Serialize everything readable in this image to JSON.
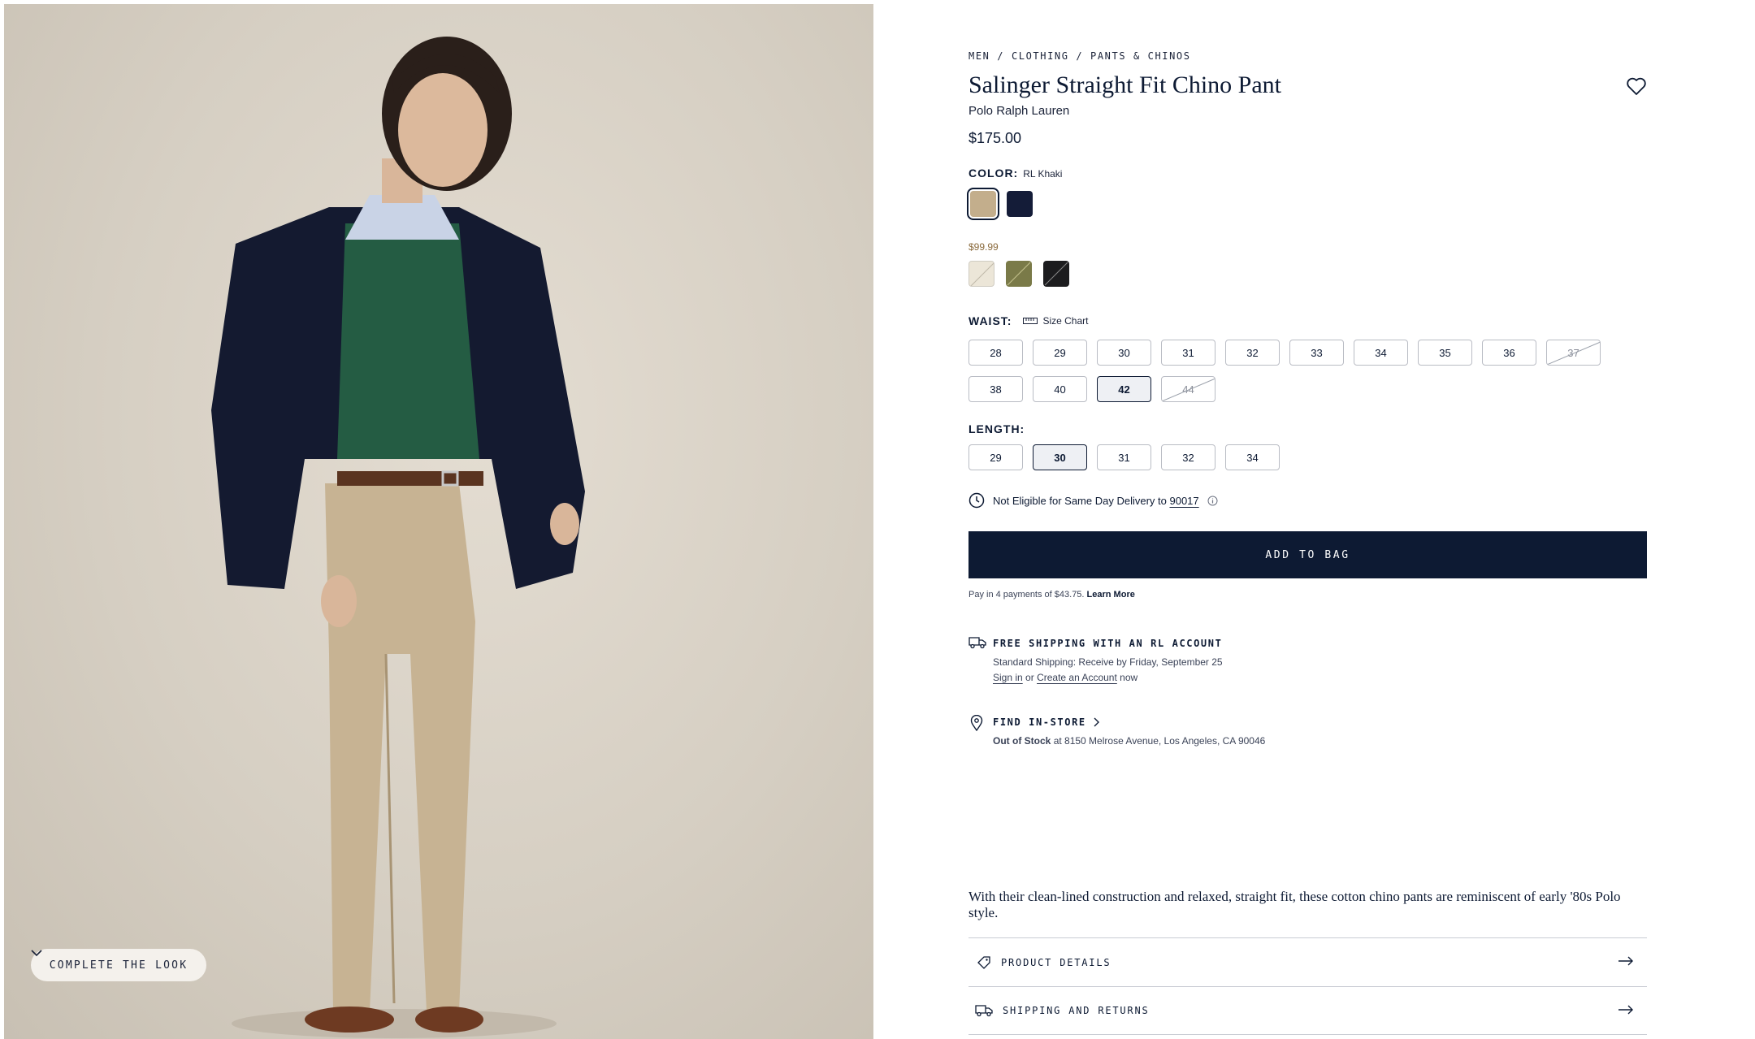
{
  "hero": {
    "complete_look_label": "COMPLETE THE LOOK"
  },
  "product": {
    "breadcrumb": "MEN / CLOTHING / PANTS & CHINOS",
    "title": "Salinger Straight Fit Chino Pant",
    "brand": "Polo Ralph Lauren",
    "price": "$175.00",
    "color_label": "COLOR:",
    "color_value": "RL Khaki",
    "colors": [
      {
        "name": "RL Khaki",
        "hex": "#c3ae8c",
        "selected": true
      },
      {
        "name": "Navy",
        "hex": "#141c38",
        "selected": false
      }
    ],
    "sale_price": "$99.99",
    "sale_colors": [
      {
        "hex": "#ece6d8"
      },
      {
        "hex": "#7a7a48"
      },
      {
        "hex": "#1c1c1e"
      }
    ],
    "waist_label": "WAIST:",
    "size_chart_label": "Size Chart",
    "waist_sizes": [
      {
        "label": "28",
        "state": "available"
      },
      {
        "label": "29",
        "state": "available"
      },
      {
        "label": "30",
        "state": "available"
      },
      {
        "label": "31",
        "state": "available"
      },
      {
        "label": "32",
        "state": "available"
      },
      {
        "label": "33",
        "state": "available"
      },
      {
        "label": "34",
        "state": "available"
      },
      {
        "label": "35",
        "state": "available"
      },
      {
        "label": "36",
        "state": "available"
      },
      {
        "label": "37",
        "state": "unavailable"
      },
      {
        "label": "38",
        "state": "available"
      },
      {
        "label": "40",
        "state": "available"
      },
      {
        "label": "42",
        "state": "selected"
      },
      {
        "label": "44",
        "state": "unavailable"
      }
    ],
    "length_label": "LENGTH:",
    "length_sizes": [
      {
        "label": "29",
        "state": "available"
      },
      {
        "label": "30",
        "state": "selected"
      },
      {
        "label": "31",
        "state": "available"
      },
      {
        "label": "32",
        "state": "available"
      },
      {
        "label": "34",
        "state": "available"
      }
    ],
    "delivery_text": "Not Eligible for Same Day Delivery to",
    "delivery_zip": "90017",
    "add_to_bag": "ADD TO BAG",
    "pay_text": "Pay in 4 payments of $43.75.",
    "pay_link": "Learn More",
    "shipping_title": "FREE SHIPPING WITH AN RL ACCOUNT",
    "shipping_line": "Standard Shipping: Receive by Friday, September 25",
    "sign_in": "Sign in",
    "or": "or",
    "create_account": "Create an Account",
    "now": "now",
    "find_store": "FIND IN-STORE",
    "stock_status": "Out of Stock",
    "stock_location": "at 8150 Melrose Avenue, Los Angeles, CA 90046",
    "description": "With their clean-lined construction and relaxed, straight fit, these cotton chino pants are reminiscent of early '80s Polo style.",
    "accordions": [
      {
        "label": "PRODUCT DETAILS",
        "icon": "tag-icon"
      },
      {
        "label": "SHIPPING AND RETURNS",
        "icon": "truck-icon"
      }
    ]
  }
}
